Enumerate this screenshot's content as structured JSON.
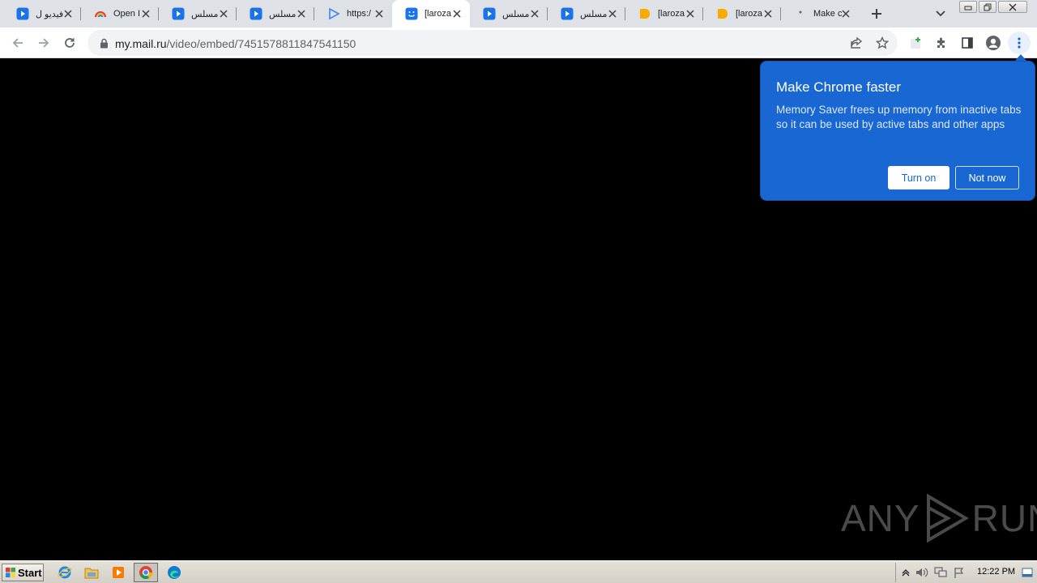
{
  "tabs": [
    {
      "title": "فيديو ل",
      "favicon": "play-icon",
      "color": "#1a73e8"
    },
    {
      "title": "Open I",
      "favicon": "rainbow-icon",
      "color": "#e8710a"
    },
    {
      "title": "مسلس",
      "favicon": "play-icon",
      "color": "#1a73e8"
    },
    {
      "title": "مسلس",
      "favicon": "play-icon",
      "color": "#1a73e8"
    },
    {
      "title": "https:/",
      "favicon": "play-outline-icon",
      "color": "#4285f4"
    },
    {
      "title": "[laroza",
      "favicon": "smile-icon",
      "color": "#1a73e8",
      "active": true
    },
    {
      "title": "مسلس",
      "favicon": "play-icon",
      "color": "#1a73e8"
    },
    {
      "title": "مسلس",
      "favicon": "play-icon",
      "color": "#1a73e8"
    },
    {
      "title": "[laroza",
      "favicon": "orange-icon",
      "color": "#f9ab00"
    },
    {
      "title": "[laroza",
      "favicon": "orange-icon",
      "color": "#f9ab00"
    },
    {
      "title": "Make c",
      "favicon": "dot-icon",
      "color": "#5f6368"
    }
  ],
  "address": {
    "host": "my.mail.ru",
    "path": "/video/embed/7451578811847541150"
  },
  "promo": {
    "title": "Make Chrome faster",
    "body": "Memory Saver frees up memory from inactive tabs so it can be used by active tabs and other apps",
    "primary_label": "Turn on",
    "secondary_label": "Not now"
  },
  "watermark": {
    "left": "ANY",
    "right": "RUN"
  },
  "taskbar": {
    "start_label": "Start",
    "clock": "12:22 PM"
  },
  "colors": {
    "promo_bg": "#1967d2",
    "tabstrip_bg": "#dee1e6"
  }
}
